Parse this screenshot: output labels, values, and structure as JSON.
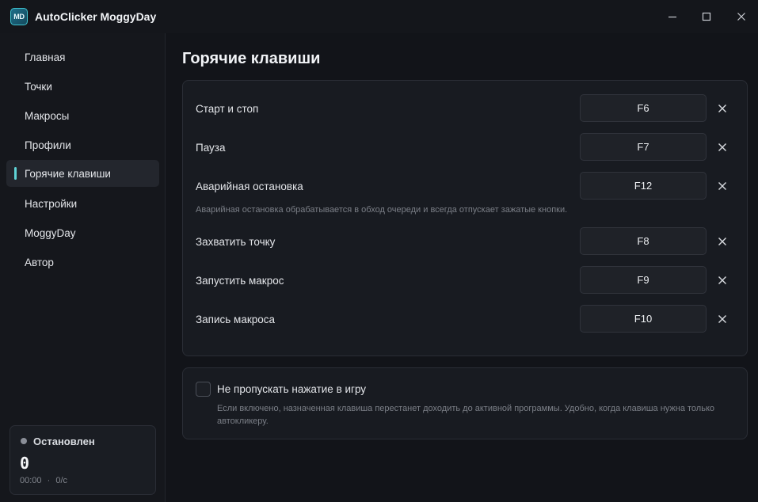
{
  "app": {
    "logo_text": "MD",
    "title": "AutoClicker MoggyDay"
  },
  "sidebar": {
    "items": [
      {
        "label": "Главная"
      },
      {
        "label": "Точки"
      },
      {
        "label": "Макросы"
      },
      {
        "label": "Профили"
      },
      {
        "label": "Горячие клавиши",
        "active": true
      },
      {
        "label": "Настройки"
      },
      {
        "label": "MoggyDay"
      },
      {
        "label": "Автор"
      }
    ]
  },
  "status": {
    "label": "Остановлен",
    "count": "0",
    "time": "00:00",
    "separator": "·",
    "rate": "0/с"
  },
  "page": {
    "title": "Горячие клавиши"
  },
  "hotkeys": [
    {
      "label": "Старт и стоп",
      "key": "F6"
    },
    {
      "label": "Пауза",
      "key": "F7"
    },
    {
      "label": "Аварийная остановка",
      "key": "F12"
    },
    {
      "label": "Захватить точку",
      "key": "F8"
    },
    {
      "label": "Запустить макрос",
      "key": "F9"
    },
    {
      "label": "Запись макроса",
      "key": "F10"
    }
  ],
  "hotkey_note": "Аварийная остановка обрабатывается в обход очереди и всегда отпускает зажатые кнопки.",
  "option": {
    "checked": false,
    "label": "Не пропускать нажатие в игру",
    "description": "Если включено, назначенная клавиша перестанет доходить до активной программы. Удобно, когда клавиша нужна только автокликеру."
  },
  "colors": {
    "accent": "#5fd3d6",
    "background": "#121419",
    "card": "#181b21"
  }
}
